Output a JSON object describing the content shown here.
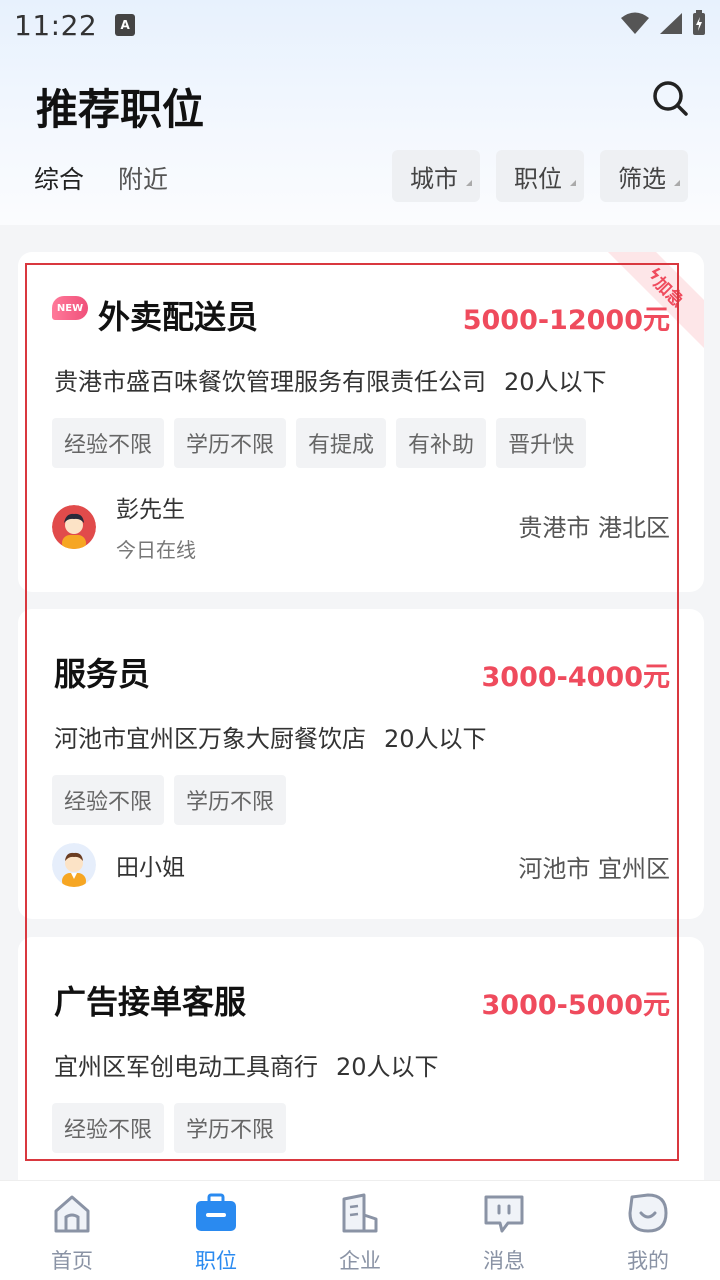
{
  "status_bar": {
    "time": "11:22",
    "app_icon_letter": "A"
  },
  "header": {
    "title": "推荐职位",
    "tabs": [
      {
        "label": "综合"
      },
      {
        "label": "附近"
      }
    ],
    "filters": [
      {
        "label": "城市"
      },
      {
        "label": "职位"
      },
      {
        "label": "筛选"
      }
    ]
  },
  "jobs": [
    {
      "badge": "NEW",
      "urgent_label": "加急",
      "title": "外卖配送员",
      "salary": "5000-12000元",
      "company": "贵港市盛百味餐饮管理服务有限责任公司",
      "size": "20人以下",
      "tags": [
        "经验不限",
        "学历不限",
        "有提成",
        "有补助",
        "晋升快"
      ],
      "recruiter": {
        "name": "彭先生",
        "status": "今日在线"
      },
      "location": "贵港市 港北区"
    },
    {
      "title": "服务员",
      "salary": "3000-4000元",
      "company": "河池市宜州区万象大厨餐饮店",
      "size": "20人以下",
      "tags": [
        "经验不限",
        "学历不限"
      ],
      "recruiter": {
        "name": "田小姐"
      },
      "location": "河池市 宜州区"
    },
    {
      "title": "广告接单客服",
      "salary": "3000-5000元",
      "company": "宜州区军创电动工具商行",
      "size": "20人以下",
      "tags": [
        "经验不限",
        "学历不限"
      ]
    }
  ],
  "bottom_nav": [
    {
      "label": "首页",
      "icon": "home-icon"
    },
    {
      "label": "职位",
      "icon": "briefcase-icon",
      "active": true
    },
    {
      "label": "企业",
      "icon": "building-icon"
    },
    {
      "label": "消息",
      "icon": "message-icon"
    },
    {
      "label": "我的",
      "icon": "profile-icon"
    }
  ],
  "colors": {
    "accent": "#2a8af0",
    "salary": "#ef4b5d",
    "highlight": "#d9383f"
  }
}
